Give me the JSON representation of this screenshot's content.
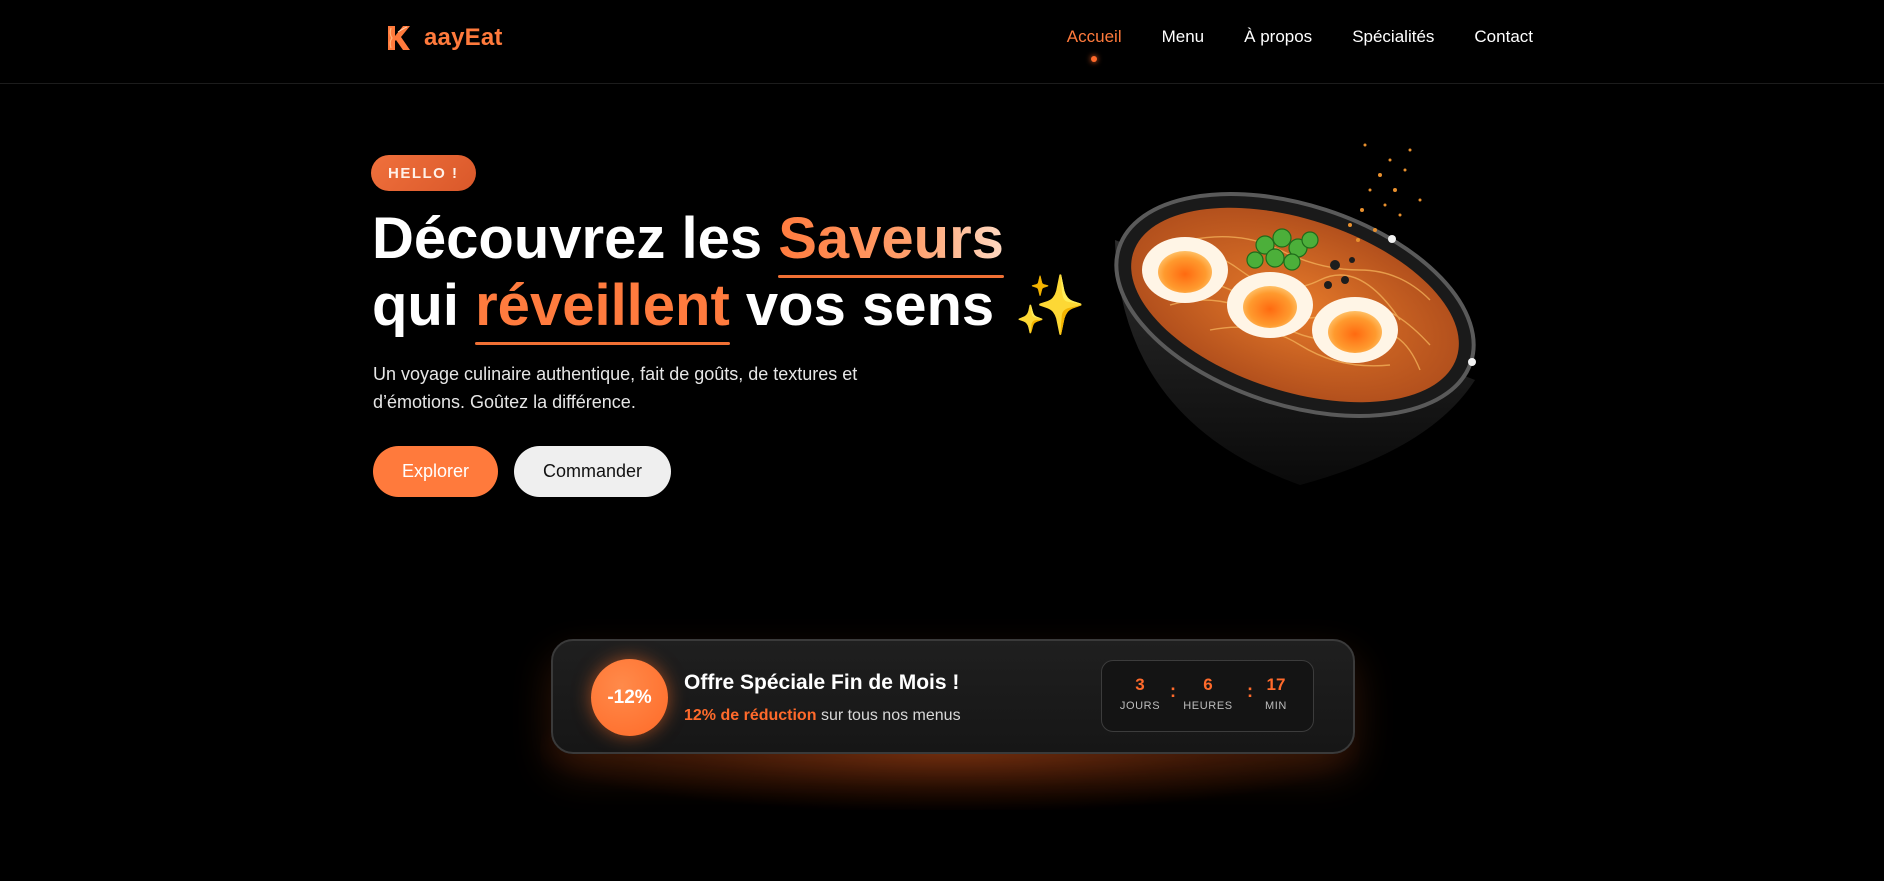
{
  "brand": {
    "name": "aayEat",
    "logo_icon": "flame-k-logo-icon",
    "accent": "#ff7a3c"
  },
  "nav": {
    "items": [
      {
        "label": "Accueil",
        "active": true
      },
      {
        "label": "Menu",
        "active": false
      },
      {
        "label": "À propos",
        "active": false
      },
      {
        "label": "Spécialités",
        "active": false
      },
      {
        "label": "Contact",
        "active": false
      }
    ]
  },
  "hero": {
    "badge": "HELLO !",
    "title_part1": "Découvrez les",
    "title_highlight1": "Saveurs",
    "title_part2": "qui",
    "title_highlight2": "réveillent",
    "title_part3": "vos sens",
    "title_emoji": "✨",
    "description": "Un voyage culinaire authentique, fait de goûts, de textures et d’émotions. Goûtez la différence.",
    "primary_button": "Explorer",
    "secondary_button": "Commander"
  },
  "promo": {
    "badge": "-12%",
    "title": "Offre Spéciale Fin de Mois !",
    "subtitle_highlight": "12% de réduction",
    "subtitle_rest": "sur tous nos menus",
    "countdown": [
      {
        "value": "3",
        "label": "JOURS"
      },
      {
        "value": "6",
        "label": "HEURES"
      },
      {
        "value": "17",
        "label": "MIN"
      }
    ],
    "separator": ":"
  },
  "colors": {
    "background": "#000000",
    "accent": "#ff7a3c",
    "accent_dark": "#ff6a2b"
  }
}
